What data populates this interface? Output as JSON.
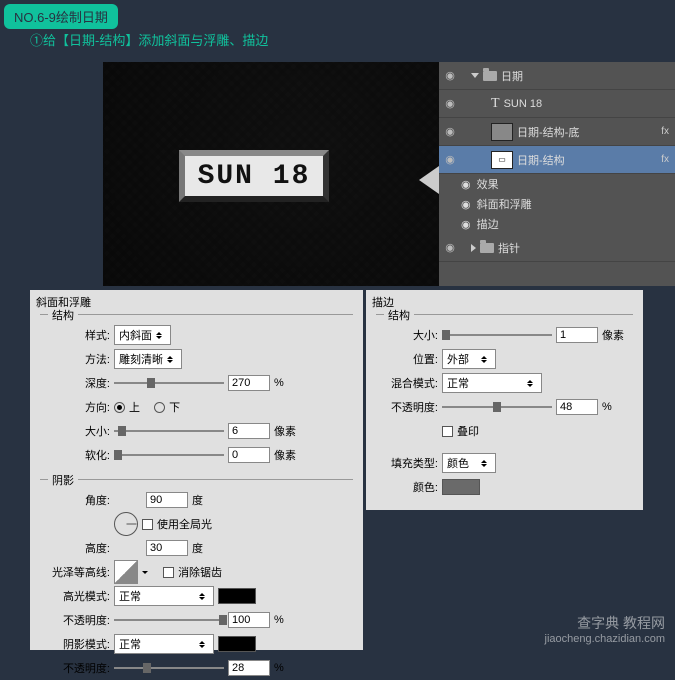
{
  "title_badge": "NO.6-9绘制日期",
  "subtitle": "①给【日期-结构】添加斜面与浮雕、描边",
  "preview": {
    "date_text": "SUN 18"
  },
  "layers": {
    "group": "日期",
    "text_layer": "SUN 18",
    "layer_bottom": "日期-结构-底",
    "layer_struct": "日期-结构",
    "fx_label": "效果",
    "fx1": "斜面和浮雕",
    "fx2": "描边",
    "group2": "指针",
    "fx_badge": "fx"
  },
  "bevel": {
    "panel_title": "斜面和浮雕",
    "structure_group": "结构",
    "style_label": "样式:",
    "style_value": "内斜面",
    "technique_label": "方法:",
    "technique_value": "雕刻清晰",
    "depth_label": "深度:",
    "depth_value": "270",
    "depth_unit": "%",
    "direction_label": "方向:",
    "up": "上",
    "down": "下",
    "size_label": "大小:",
    "size_value": "6",
    "size_unit": "像素",
    "soften_label": "软化:",
    "soften_value": "0",
    "soften_unit": "像素",
    "shadow_group": "阴影",
    "angle_label": "角度:",
    "angle_value": "90",
    "angle_unit": "度",
    "global_light": "使用全局光",
    "altitude_label": "高度:",
    "altitude_value": "30",
    "altitude_unit": "度",
    "gloss_label": "光泽等高线:",
    "antialias": "消除锯齿",
    "highlight_mode_label": "高光模式:",
    "highlight_mode_value": "正常",
    "highlight_opacity_label": "不透明度:",
    "highlight_opacity_value": "100",
    "highlight_opacity_unit": "%",
    "shadow_mode_label": "阴影模式:",
    "shadow_mode_value": "正常",
    "shadow_opacity_label": "不透明度:",
    "shadow_opacity_value": "28",
    "shadow_opacity_unit": "%",
    "highlight_color": "#000000",
    "shadow_color": "#000000"
  },
  "stroke": {
    "panel_title": "描边",
    "structure_group": "结构",
    "size_label": "大小:",
    "size_value": "1",
    "size_unit": "像素",
    "position_label": "位置:",
    "position_value": "外部",
    "blend_label": "混合模式:",
    "blend_value": "正常",
    "opacity_label": "不透明度:",
    "opacity_value": "48",
    "opacity_unit": "%",
    "overprint": "叠印",
    "fill_type_label": "填充类型:",
    "fill_type_value": "颜色",
    "color_label": "颜色:",
    "color_value": "#6a6a6a"
  },
  "watermark": {
    "line1": "查字典 教程网",
    "line2": "jiaocheng.chazidian.com"
  }
}
